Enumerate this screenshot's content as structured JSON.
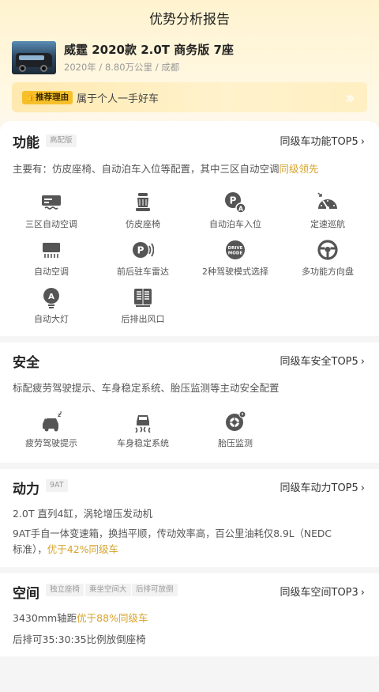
{
  "header": {
    "title": "优势分析报告"
  },
  "car": {
    "name": "威霆 2020款 2.0T 商务版 7座",
    "meta": "2020年 / 8.80万公里 / 成都"
  },
  "reason": {
    "badge": "推荐理由",
    "text": "属于个人一手好车"
  },
  "function": {
    "title": "功能",
    "tag": "高配版",
    "rank": "同级车功能TOP5",
    "desc_prefix": "主要有：仿皮座椅、自动泊车入位等配置，其中三区自动空调",
    "desc_highlight": "同级领先",
    "features": [
      {
        "label": "三区自动空调",
        "icon": "ac-panel-icon"
      },
      {
        "label": "仿皮座椅",
        "icon": "seat-icon"
      },
      {
        "label": "自动泊车入位",
        "icon": "auto-parking-icon"
      },
      {
        "label": "定速巡航",
        "icon": "cruise-control-icon"
      },
      {
        "label": "自动空调",
        "icon": "auto-ac-icon"
      },
      {
        "label": "前后驻车雷达",
        "icon": "parking-radar-icon"
      },
      {
        "label": "2种驾驶模式选择",
        "icon": "drive-mode-icon"
      },
      {
        "label": "多功能方向盘",
        "icon": "steering-wheel-icon"
      },
      {
        "label": "自动大灯",
        "icon": "auto-headlight-icon"
      },
      {
        "label": "后排出风口",
        "icon": "rear-vent-icon"
      }
    ],
    "drive_mode_text": [
      "DRIVE",
      "MODE"
    ]
  },
  "safety": {
    "title": "安全",
    "rank": "同级车安全TOP5",
    "desc": "标配疲劳驾驶提示、车身稳定系统、胎压监测等主动安全配置",
    "features": [
      {
        "label": "疲劳驾驶提示",
        "icon": "fatigue-alert-icon"
      },
      {
        "label": "车身稳定系统",
        "icon": "stability-control-icon"
      },
      {
        "label": "胎压监测",
        "icon": "tire-pressure-icon"
      }
    ]
  },
  "power": {
    "title": "动力",
    "tag": "9AT",
    "rank": "同级车动力TOP5",
    "line1": "2.0T 直列4缸，涡轮增压发动机",
    "line2": "9AT手自一体变速箱，换挡平顺，传动效率高，百公里油耗仅8.9L（NEDC",
    "line3_prefix": "标准），",
    "line3_highlight": "优于42%同级车"
  },
  "space": {
    "title": "空间",
    "tags": [
      "独立座椅",
      "乘坐空间大",
      "后排可放倒"
    ],
    "rank": "同级车空间TOP3",
    "line1_prefix": "3430mm轴距",
    "line1_highlight": "优于88%同级车",
    "line2": "后排可35:30:35比例放倒座椅"
  },
  "colors": {
    "accent": "#d6a32a",
    "badge": "#f6c02a",
    "icon": "#555555"
  }
}
